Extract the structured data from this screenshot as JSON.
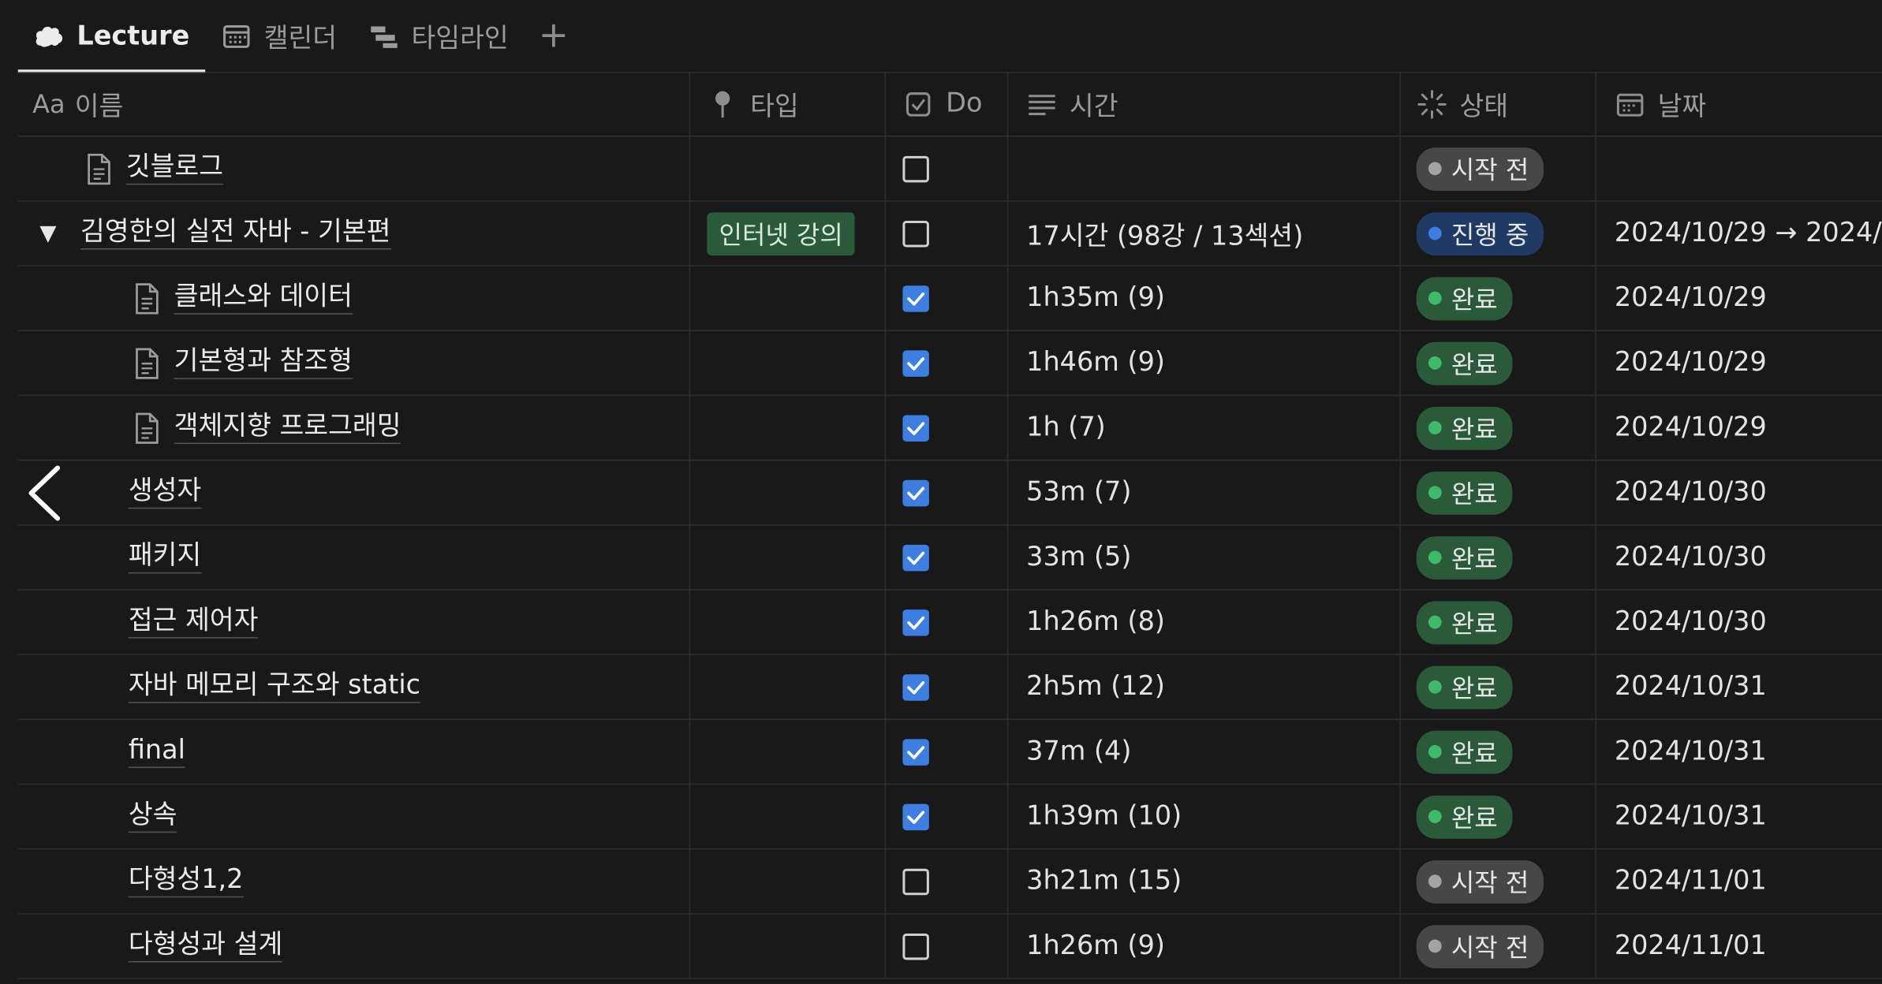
{
  "tabs": [
    {
      "label": "Lecture",
      "icon": "cloud-icon",
      "active": true
    },
    {
      "label": "캘린더",
      "icon": "calendar-icon",
      "active": false
    },
    {
      "label": "타임라인",
      "icon": "timeline-icon",
      "active": false
    }
  ],
  "add_view_label": "+",
  "columns": {
    "name_prefix": "Aa",
    "name": "이름",
    "type": "타입",
    "do": "Do",
    "time": "시간",
    "status": "상태",
    "date": "날짜"
  },
  "rows": [
    {
      "name": "깃블로그",
      "icon": "document-icon",
      "indent": 1,
      "type": "",
      "done": false,
      "time": "",
      "status": "시작 전",
      "status_color": "grey",
      "date": ""
    },
    {
      "name": "김영한의 실전 자바 - 기본편",
      "toggle": "▼",
      "indent": 0,
      "type": "인터넷 강의",
      "done": false,
      "time": "17시간 (98강 / 13섹션)",
      "status": "진행 중",
      "status_color": "blue",
      "date": "2024/10/29 → 2024/"
    },
    {
      "name": "클래스와 데이터",
      "icon": "document-icon",
      "indent": 2,
      "type": "",
      "done": true,
      "time": "1h35m (9)",
      "status": "완료",
      "status_color": "green",
      "date": "2024/10/29"
    },
    {
      "name": "기본형과 참조형",
      "icon": "document-icon",
      "indent": 2,
      "type": "",
      "done": true,
      "time": "1h46m (9)",
      "status": "완료",
      "status_color": "green",
      "date": "2024/10/29"
    },
    {
      "name": "객체지향 프로그래밍",
      "icon": "document-icon",
      "indent": 2,
      "type": "",
      "done": true,
      "time": "1h (7)",
      "status": "완료",
      "status_color": "green",
      "date": "2024/10/29"
    },
    {
      "name": "생성자",
      "indent": 3,
      "type": "",
      "done": true,
      "time": "53m (7)",
      "status": "완료",
      "status_color": "green",
      "date": "2024/10/30"
    },
    {
      "name": "패키지",
      "indent": 3,
      "type": "",
      "done": true,
      "time": "33m (5)",
      "status": "완료",
      "status_color": "green",
      "date": "2024/10/30"
    },
    {
      "name": "접근 제어자",
      "indent": 3,
      "type": "",
      "done": true,
      "time": "1h26m (8)",
      "status": "완료",
      "status_color": "green",
      "date": "2024/10/30"
    },
    {
      "name": "자바 메모리 구조와 static",
      "indent": 3,
      "type": "",
      "done": true,
      "time": "2h5m (12)",
      "status": "완료",
      "status_color": "green",
      "date": "2024/10/31"
    },
    {
      "name": "final",
      "indent": 3,
      "type": "",
      "done": true,
      "time": "37m (4)",
      "status": "완료",
      "status_color": "green",
      "date": "2024/10/31"
    },
    {
      "name": "상속",
      "indent": 3,
      "type": "",
      "done": true,
      "time": "1h39m (10)",
      "status": "완료",
      "status_color": "green",
      "date": "2024/10/31"
    },
    {
      "name": "다형성1,2",
      "indent": 3,
      "type": "",
      "done": false,
      "time": "3h21m (15)",
      "status": "시작 전",
      "status_color": "grey",
      "date": "2024/11/01"
    },
    {
      "name": "다형성과 설계",
      "indent": 3,
      "type": "",
      "done": false,
      "time": "1h26m (9)",
      "status": "시작 전",
      "status_color": "grey",
      "date": "2024/11/01"
    }
  ],
  "colors": {
    "background": "#191919",
    "checkbox_checked": "#3d7ee0",
    "status_done": "#2b5a3a",
    "status_in_progress": "#1f3a64",
    "status_not_started": "#474747",
    "tag_green": "#2b5a3a"
  }
}
